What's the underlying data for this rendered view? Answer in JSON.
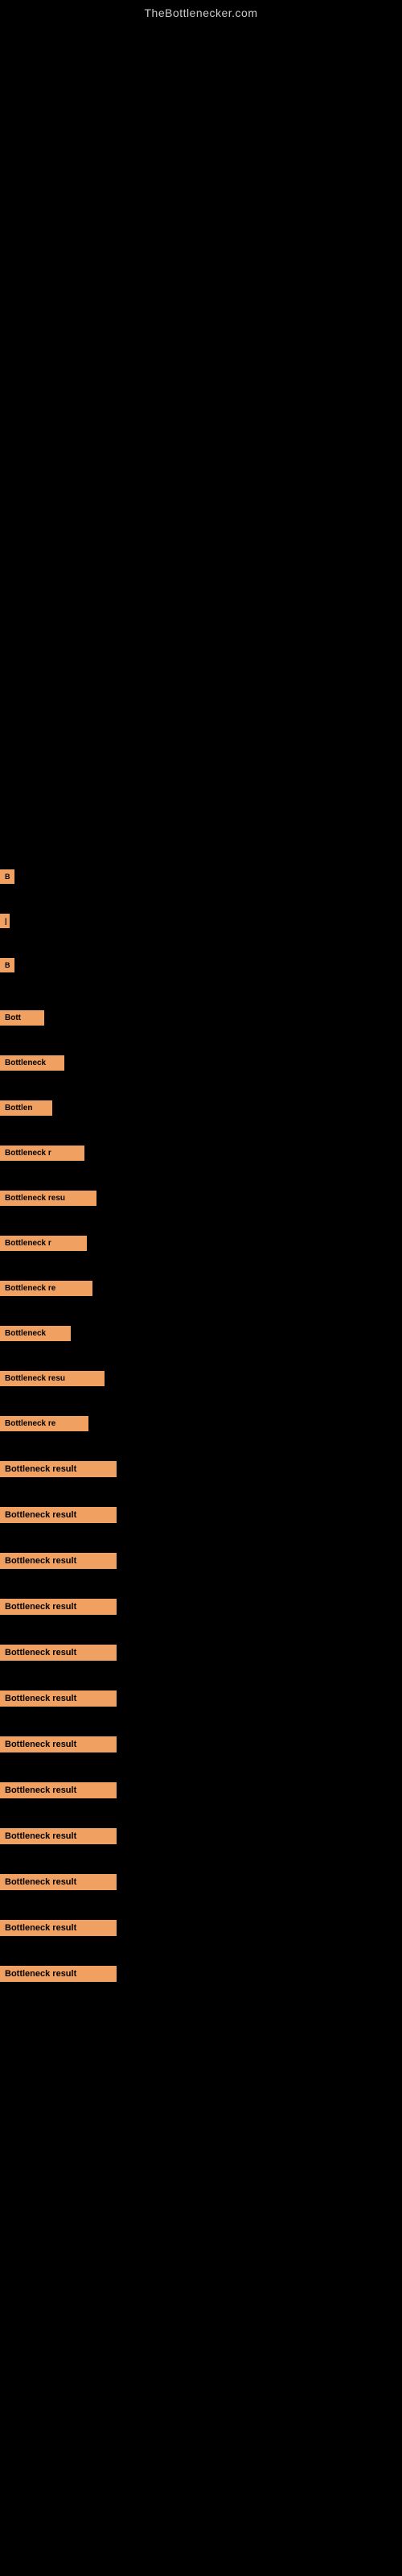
{
  "site": {
    "title": "TheBottlenecker.com"
  },
  "items": [
    {
      "id": 1,
      "label": "B",
      "class": "item-1"
    },
    {
      "id": 2,
      "label": "|",
      "class": "item-2"
    },
    {
      "id": 3,
      "label": "B",
      "class": "item-3"
    },
    {
      "id": 4,
      "label": "Bott",
      "class": "item-4"
    },
    {
      "id": 5,
      "label": "Bottleneck",
      "class": "item-5"
    },
    {
      "id": 6,
      "label": "Bottlen",
      "class": "item-6"
    },
    {
      "id": 7,
      "label": "Bottleneck r",
      "class": "item-7"
    },
    {
      "id": 8,
      "label": "Bottleneck resu",
      "class": "item-8"
    },
    {
      "id": 9,
      "label": "Bottleneck r",
      "class": "item-9"
    },
    {
      "id": 10,
      "label": "Bottleneck re",
      "class": "item-10"
    },
    {
      "id": 11,
      "label": "Bottleneck",
      "class": "item-11"
    },
    {
      "id": 12,
      "label": "Bottleneck resu",
      "class": "item-12"
    },
    {
      "id": 13,
      "label": "Bottleneck re",
      "class": "item-13"
    },
    {
      "id": 14,
      "label": "Bottleneck result",
      "class": "item-14"
    },
    {
      "id": 15,
      "label": "Bottleneck result",
      "class": "item-15"
    },
    {
      "id": 16,
      "label": "Bottleneck result",
      "class": "item-16"
    },
    {
      "id": 17,
      "label": "Bottleneck result",
      "class": "item-17"
    },
    {
      "id": 18,
      "label": "Bottleneck result",
      "class": "item-18"
    },
    {
      "id": 19,
      "label": "Bottleneck result",
      "class": "item-19"
    },
    {
      "id": 20,
      "label": "Bottleneck result",
      "class": "item-20"
    },
    {
      "id": 21,
      "label": "Bottleneck result",
      "class": "item-21"
    },
    {
      "id": 22,
      "label": "Bottleneck result",
      "class": "item-22"
    },
    {
      "id": 23,
      "label": "Bottleneck result",
      "class": "item-23"
    },
    {
      "id": 24,
      "label": "Bottleneck result",
      "class": "item-24"
    },
    {
      "id": 25,
      "label": "Bottleneck result",
      "class": "item-25"
    }
  ],
  "colors": {
    "background": "#000000",
    "label_bg": "#f0a060",
    "label_text": "#000000",
    "title_text": "#cccccc"
  }
}
